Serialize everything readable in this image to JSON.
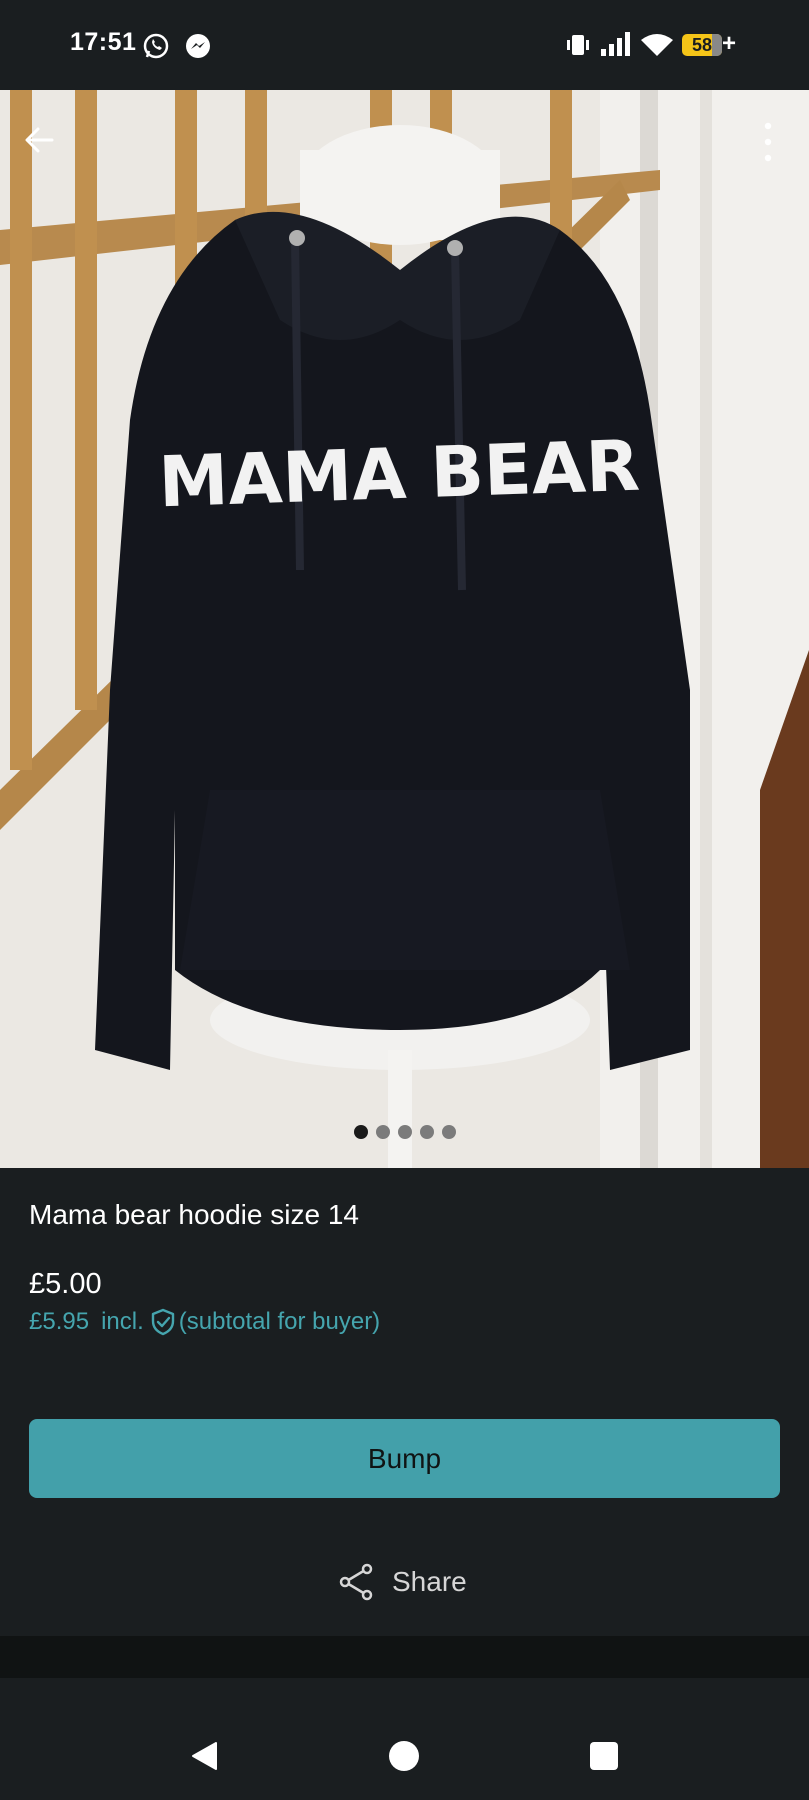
{
  "status_bar": {
    "time": "17:51",
    "battery_level": "58",
    "battery_suffix": "+",
    "icons": [
      "whatsapp-icon",
      "messenger-icon",
      "vibrate-icon",
      "signal-icon",
      "wifi-icon",
      "battery-icon"
    ]
  },
  "photo": {
    "print_text": "MAMA BEAR",
    "page_count": 5,
    "active_page": 1
  },
  "listing": {
    "title": "Mama bear hoodie size 14",
    "price": "£5.00",
    "buyer_price": "£5.95",
    "buyer_incl": "incl.",
    "buyer_note": "(subtotal for buyer)"
  },
  "actions": {
    "bump_label": "Bump",
    "share_label": "Share"
  },
  "colors": {
    "background": "#1a1e20",
    "accent": "#43a0aa",
    "accent_text": "#45a5ae"
  }
}
